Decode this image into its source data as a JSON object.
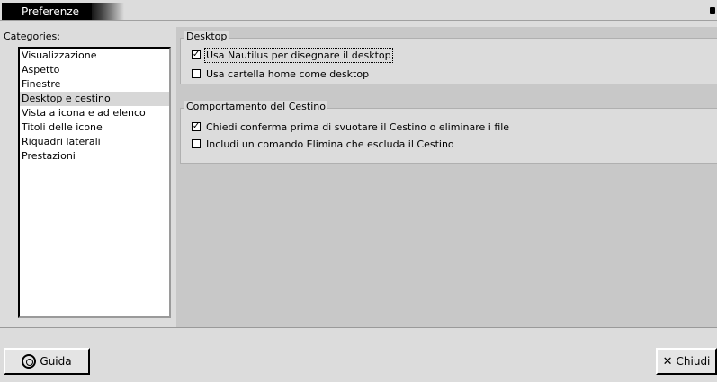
{
  "window": {
    "title": "Preferenze"
  },
  "sidebar": {
    "label": "Categories:",
    "items": [
      {
        "label": "Visualizzazione"
      },
      {
        "label": "Aspetto"
      },
      {
        "label": "Finestre"
      },
      {
        "label": "Desktop e cestino"
      },
      {
        "label": "Vista a icona e ad elenco"
      },
      {
        "label": "Titoli delle icone"
      },
      {
        "label": "Riquadri laterali"
      },
      {
        "label": "Prestazioni"
      }
    ],
    "selected_index": 3
  },
  "desktop_group": {
    "title": "Desktop",
    "options": [
      {
        "label": "Usa Nautilus per disegnare il desktop",
        "checked": true
      },
      {
        "label": "Usa cartella home come desktop",
        "checked": false
      }
    ]
  },
  "trash_group": {
    "title": "Comportamento del Cestino",
    "options": [
      {
        "label": "Chiedi conferma prima di svuotare il Cestino o eliminare i file",
        "checked": true
      },
      {
        "label": "Includi un comando Elimina che escluda il Cestino",
        "checked": false
      }
    ]
  },
  "buttons": {
    "help_label": "Guida",
    "close_label": "Chiudi"
  },
  "icons": {
    "help": "help-icon",
    "close": "close-icon",
    "check": "✓"
  }
}
